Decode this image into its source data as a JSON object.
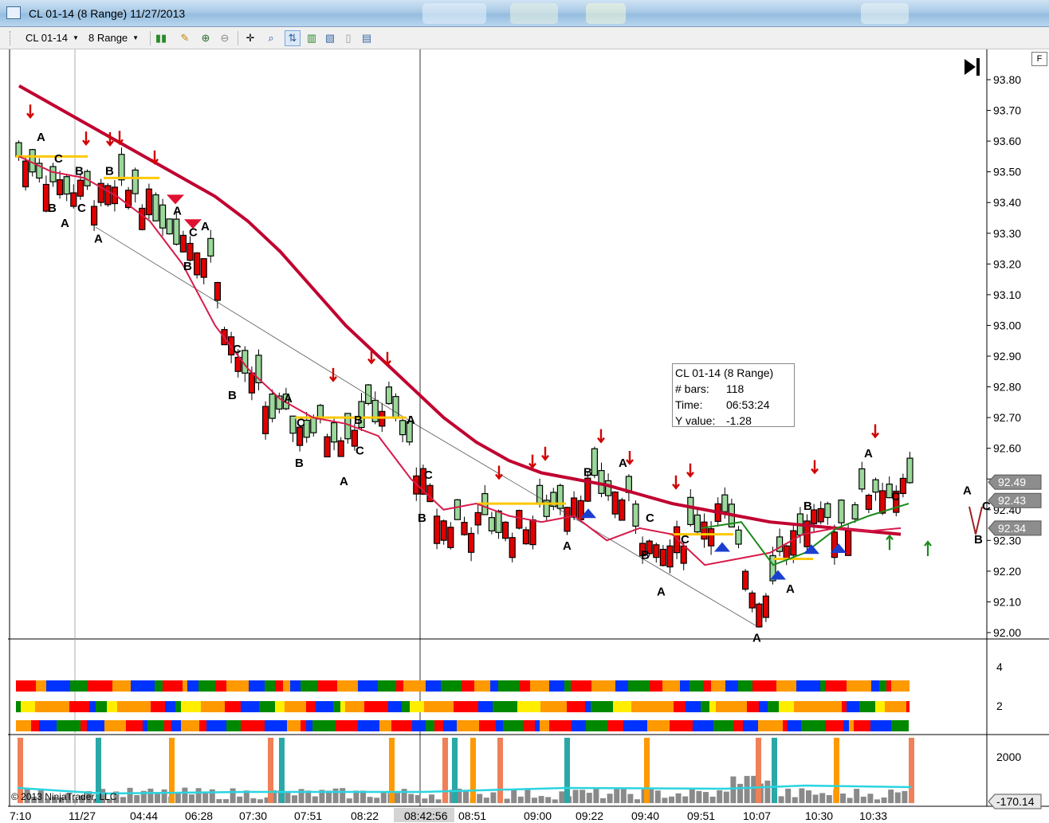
{
  "window": {
    "title": "CL 01-14 (8 Range)  11/27/2013"
  },
  "toolbar": {
    "instrument": "CL 01-14",
    "period": "8 Range",
    "icons": [
      "bar-style-icon",
      "pencil-icon",
      "magnify-plus-icon",
      "magnify-minus-icon",
      "crosshair-icon",
      "zoom-icon",
      "chart-trader-icon",
      "indicators-icon",
      "strategies-icon",
      "properties-icon",
      "data-box-icon"
    ]
  },
  "chart": {
    "f_label": "F",
    "copyright": "© 2013 NinjaTrader, LLC",
    "price_axis": [
      "93.80",
      "93.70",
      "93.60",
      "93.50",
      "93.40",
      "93.30",
      "93.20",
      "93.10",
      "93.00",
      "92.90",
      "92.80",
      "92.70",
      "92.60",
      "92.50",
      "92.40",
      "92.30",
      "92.20",
      "92.10",
      "92.00"
    ],
    "price_badges": [
      "92.49",
      "92.43",
      "92.34"
    ],
    "indicator_axis": [
      "4",
      "2"
    ],
    "volume_axis": [
      "2000"
    ],
    "volume_badge": "-170.14",
    "time_axis": [
      "7:10",
      "11/27",
      "04:44",
      "06:28",
      "07:30",
      "07:51",
      "08:22",
      "08:42:56",
      "08:51",
      "09:00",
      "09:22",
      "09:40",
      "09:51",
      "10:07",
      "10:30",
      "10:33"
    ],
    "colors": {
      "up_candle": "#9bd89b",
      "down_candle": "#e00000",
      "slow_ma": "#c00030",
      "fast_ma": "#d81b4a",
      "level_line": "#ffc800",
      "volume": "#8a8a8a",
      "volume_avg": "#2ad4e0"
    }
  },
  "tooltip": {
    "title": "CL 01-14 (8 Range)",
    "rows": [
      {
        "key": "# bars:",
        "value": "118"
      },
      {
        "key": "Time:",
        "value": "06:53:24"
      },
      {
        "key": "Y value:",
        "value": "-1.28"
      }
    ]
  },
  "chart_data": {
    "type": "candlestick",
    "title": "CL 01-14 (8 Range)",
    "ylim": [
      92.0,
      93.8
    ],
    "y_ticks": [
      93.8,
      93.7,
      93.6,
      93.5,
      93.4,
      93.3,
      93.2,
      93.1,
      93.0,
      92.9,
      92.8,
      92.7,
      92.6,
      92.5,
      92.4,
      92.3,
      92.2,
      92.1,
      92.0
    ],
    "x_ticks": [
      "7:10",
      "11/27",
      "04:44",
      "06:28",
      "07:30",
      "07:51",
      "08:22",
      "08:42:56",
      "08:51",
      "09:00",
      "09:22",
      "09:40",
      "09:51",
      "10:07",
      "10:30",
      "10:33"
    ],
    "slow_ma": [
      93.78,
      93.72,
      93.66,
      93.6,
      93.54,
      93.48,
      93.42,
      93.34,
      93.24,
      93.12,
      93.0,
      92.9,
      92.8,
      92.7,
      92.62,
      92.56,
      92.52,
      92.5,
      92.48,
      92.45,
      92.42,
      92.4,
      92.38,
      92.36,
      92.35,
      92.34,
      92.33,
      92.32
    ],
    "fast_ma": [
      93.55,
      93.5,
      93.48,
      93.42,
      93.34,
      93.2,
      93.0,
      92.86,
      92.76,
      92.7,
      92.68,
      92.64,
      92.5,
      92.4,
      92.42,
      92.38,
      92.36,
      92.38,
      92.3,
      92.34,
      92.32,
      92.22,
      92.24,
      92.26,
      92.32,
      92.34,
      92.33,
      92.34
    ],
    "last_prices": [
      92.49,
      92.43,
      92.34
    ],
    "indicator_ylim": [
      0,
      5
    ],
    "volume_ylim": [
      0,
      2800
    ]
  }
}
